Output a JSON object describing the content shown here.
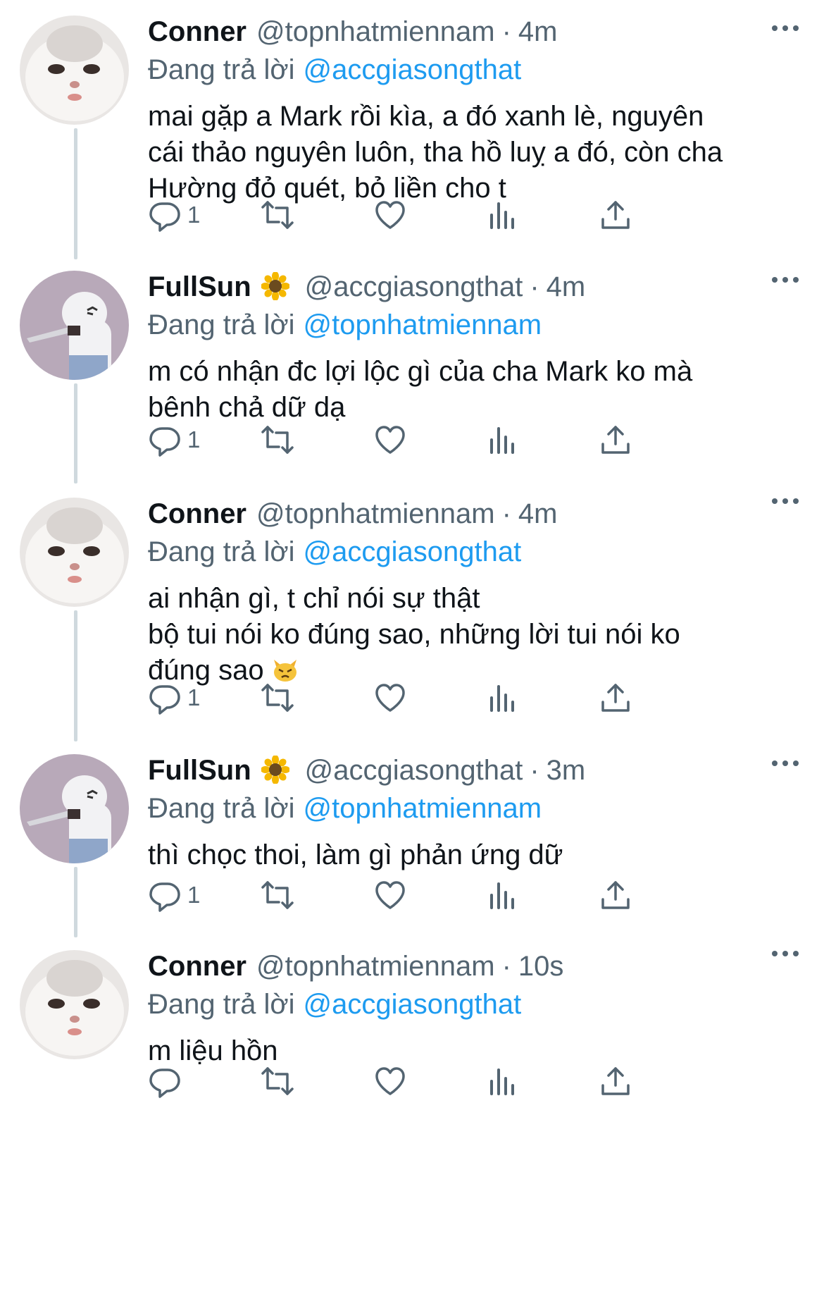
{
  "tweets": [
    {
      "name": "Conner",
      "handle": "@topnhatmiennam",
      "time": "4m",
      "reply_prefix": "Đang trả lời",
      "reply_to": "@accgiasongthat",
      "text": "mai gặp a Mark rồi kìa, a đó xanh lè, nguyên\ncái thảo nguyên luôn, tha hồ luỵ a đó, còn cha\nHường đỏ quét, bỏ liền cho t",
      "reply_count": "1",
      "avatar": "white-cat-avatar"
    },
    {
      "name": "FullSun",
      "name_emoji": "sunflower-emoji",
      "handle": "@accgiasongthat",
      "time": "4m",
      "reply_prefix": "Đang trả lời",
      "reply_to": "@topnhatmiennam",
      "text": "m có nhận đc lợi lộc gì của cha Mark ko mà\nbênh chả dữ dạ",
      "reply_count": "1",
      "avatar": "polar-bear-knife-avatar"
    },
    {
      "name": "Conner",
      "handle": "@topnhatmiennam",
      "time": "4m",
      "reply_prefix": "Đang trả lời",
      "reply_to": "@accgiasongthat",
      "text": "ai nhận gì, t chỉ nói sự thật\nbộ tui nói ko đúng sao, những lời tui nói ko\nđúng sao",
      "text_emoji": "pouting-cat-emoji",
      "reply_count": "1",
      "avatar": "white-cat-avatar"
    },
    {
      "name": "FullSun",
      "name_emoji": "sunflower-emoji",
      "handle": "@accgiasongthat",
      "time": "3m",
      "reply_prefix": "Đang trả lời",
      "reply_to": "@topnhatmiennam",
      "text": "thì chọc thoi, làm gì phản ứng dữ",
      "reply_count": "1",
      "avatar": "polar-bear-knife-avatar"
    },
    {
      "name": "Conner",
      "handle": "@topnhatmiennam",
      "time": "10s",
      "reply_prefix": "Đang trả lời",
      "reply_to": "@accgiasongthat",
      "text": "m liệu hồn",
      "reply_count": "",
      "avatar": "white-cat-avatar"
    }
  ],
  "colors": {
    "link": "#1d9bf0",
    "secondary_text": "#536471",
    "thread_line": "#cfd9de",
    "primary_text": "#0f1419"
  },
  "icons": [
    "reply-icon",
    "retweet-icon",
    "like-icon",
    "analytics-icon",
    "share-icon",
    "more-icon"
  ]
}
